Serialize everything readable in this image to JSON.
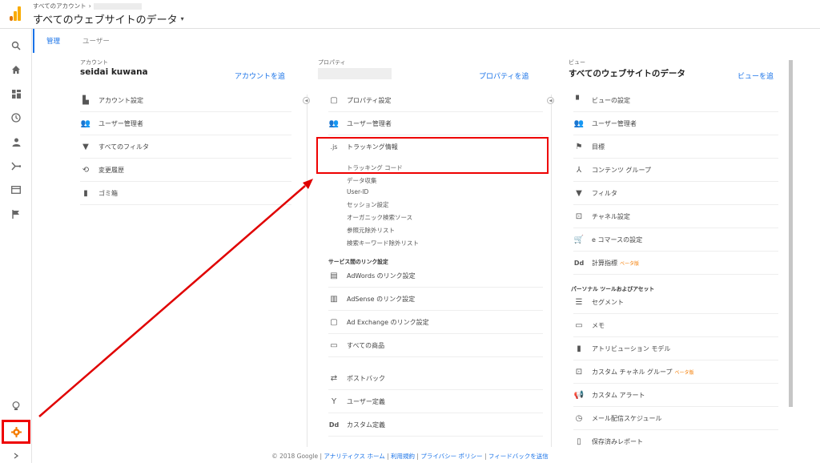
{
  "header": {
    "breadcrumb": "すべてのアカウント",
    "breadcrumb_sep": "›",
    "view_title": "すべてのウェブサイトのデータ",
    "caret": "▾"
  },
  "tabs": [
    {
      "label": "管理"
    },
    {
      "label": "ユーザー"
    }
  ],
  "account": {
    "label": "アカウント",
    "name": "seidai kuwana",
    "add_link": "アカウントを追",
    "items": [
      {
        "icon": "building-icon",
        "label": "アカウント設定"
      },
      {
        "icon": "people-icon",
        "label": "ユーザー管理者"
      },
      {
        "icon": "filter-icon",
        "label": "すべてのフィルタ"
      },
      {
        "icon": "history-icon",
        "label": "変更履歴"
      },
      {
        "icon": "trash-icon",
        "label": "ゴミ箱"
      }
    ]
  },
  "property": {
    "label": "プロパティ",
    "add_link": "プロパティを追",
    "items": [
      {
        "icon": "window-icon",
        "label": "プロパティ設定"
      },
      {
        "icon": "people-icon",
        "label": "ユーザー管理者"
      },
      {
        "icon": "js-icon",
        "icon_text": ".js",
        "label": "トラッキング情報"
      }
    ],
    "tracking_subitems": [
      "トラッキング コード",
      "データ収集",
      "User-ID",
      "セッション設定",
      "オーガニック検索ソース",
      "参照元除外リスト",
      "検索キーワード除外リスト"
    ],
    "section_links": "サービス間のリンク設定",
    "link_items": [
      {
        "icon": "adwords-icon",
        "label": "AdWords のリンク設定"
      },
      {
        "icon": "adsense-icon",
        "label": "AdSense のリンク設定"
      },
      {
        "icon": "adexchange-icon",
        "label": "Ad Exchange のリンク設定"
      },
      {
        "icon": "products-icon",
        "label": "すべての商品"
      }
    ],
    "more_items": [
      {
        "icon": "postback-icon",
        "label": "ポストバック"
      },
      {
        "icon": "user-definition-icon",
        "label": "ユーザー定義"
      },
      {
        "icon": "custom-definition-icon",
        "icon_text": "Dd",
        "label": "カスタム定義"
      }
    ]
  },
  "view": {
    "label": "ビュー",
    "name": "すべてのウェブサイトのデータ",
    "add_link": "ビューを追",
    "items": [
      {
        "icon": "document-icon",
        "label": "ビューの設定"
      },
      {
        "icon": "people-icon",
        "label": "ユーザー管理者"
      },
      {
        "icon": "flag-icon",
        "label": "目標"
      },
      {
        "icon": "content-group-icon",
        "label": "コンテンツ グループ"
      },
      {
        "icon": "filter-icon",
        "label": "フィルタ"
      },
      {
        "icon": "channel-icon",
        "label": "チャネル設定"
      },
      {
        "icon": "cart-icon",
        "label": "e コマースの設定"
      },
      {
        "icon": "calculated-metrics-icon",
        "icon_text": "Dd",
        "label": "計算指標",
        "beta": "ベータ版"
      }
    ],
    "section_personal": "パーソナル ツールおよびアセット",
    "personal_items": [
      {
        "icon": "segment-icon",
        "label": "セグメント"
      },
      {
        "icon": "memo-icon",
        "label": "メモ"
      },
      {
        "icon": "attribution-icon",
        "label": "アトリビューション モデル"
      },
      {
        "icon": "channel-icon",
        "label": "カスタム チャネル グループ",
        "beta": "ベータ版"
      },
      {
        "icon": "megaphone-icon",
        "label": "カスタム アラート"
      },
      {
        "icon": "clock-icon",
        "label": "メール配信スケジュール"
      },
      {
        "icon": "document-icon",
        "label": "保存済みレポート"
      }
    ]
  },
  "footer": {
    "copyright": "© 2018 Google |",
    "links": [
      "アナリティクス ホーム",
      "利用規約",
      "プライバシー ポリシー",
      "フィードバックを送信"
    ],
    "sep": " | "
  },
  "colors": {
    "accent": "#1a73e8",
    "annotation_red": "#e00000",
    "beta_orange": "#f57c00"
  }
}
